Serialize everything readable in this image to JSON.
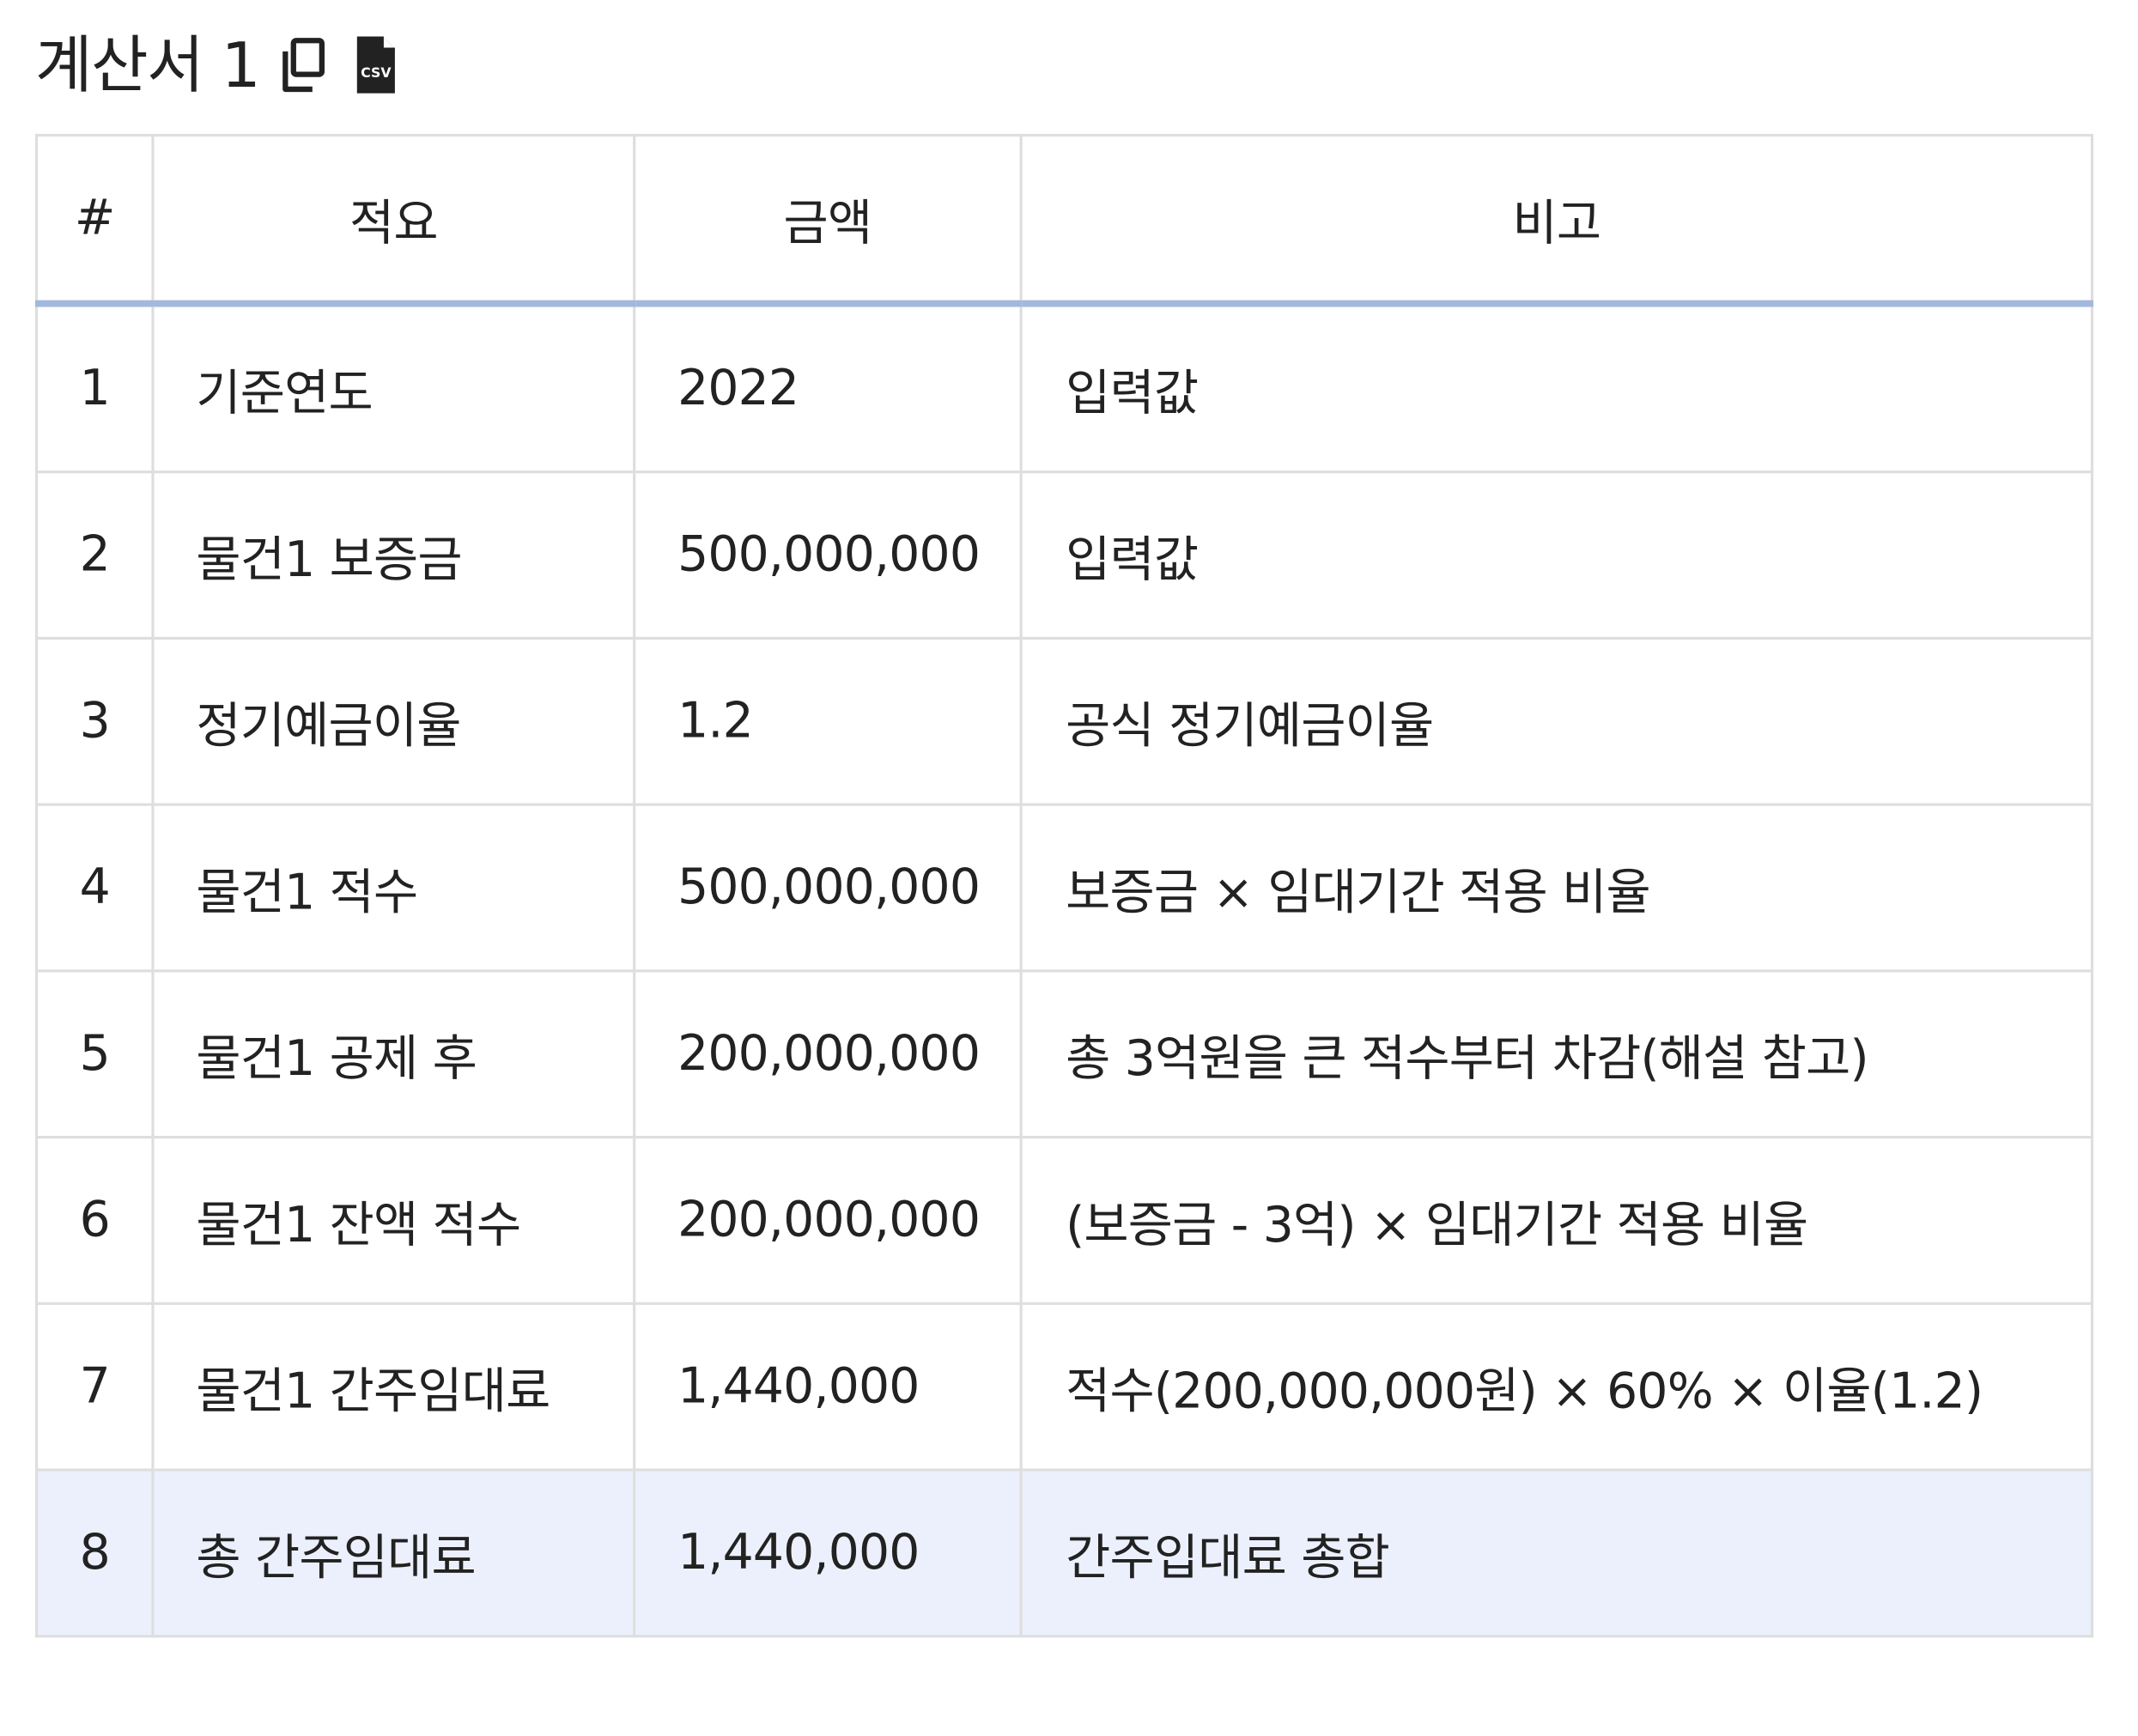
{
  "title": "계산서 1",
  "icons": {
    "copy": "copy-icon",
    "csv": "csv-file-icon",
    "csv_text": "CSV"
  },
  "colors": {
    "header_divider": "#a3b8dd",
    "highlight_row": "#ecf0fc",
    "grid": "#dedede",
    "text": "#222222"
  },
  "table": {
    "headers": [
      "#",
      "적요",
      "금액",
      "비고"
    ],
    "rows": [
      [
        "1",
        "기준연도",
        "2022",
        "입력값"
      ],
      [
        "2",
        "물건1 보증금",
        "500,000,000",
        "입력값"
      ],
      [
        "3",
        "정기예금이율",
        "1.2",
        "공식 정기예금이율"
      ],
      [
        "4",
        "물건1 적수",
        "500,000,000",
        "보증금 × 임대기간 적용 비율"
      ],
      [
        "5",
        "물건1 공제 후",
        "200,000,000",
        "총 3억원을 큰 적수부터 차감(해설 참고)"
      ],
      [
        "6",
        "물건1 잔액 적수",
        "200,000,000",
        "(보증금 - 3억) × 임대기간 적용 비율"
      ],
      [
        "7",
        "물건1 간주임대료",
        "1,440,000",
        "적수(200,000,000원) × 60% × 이율(1.2)"
      ],
      [
        "8",
        "총 간주임대료",
        "1,440,000",
        "간주입대료 총합"
      ]
    ]
  }
}
